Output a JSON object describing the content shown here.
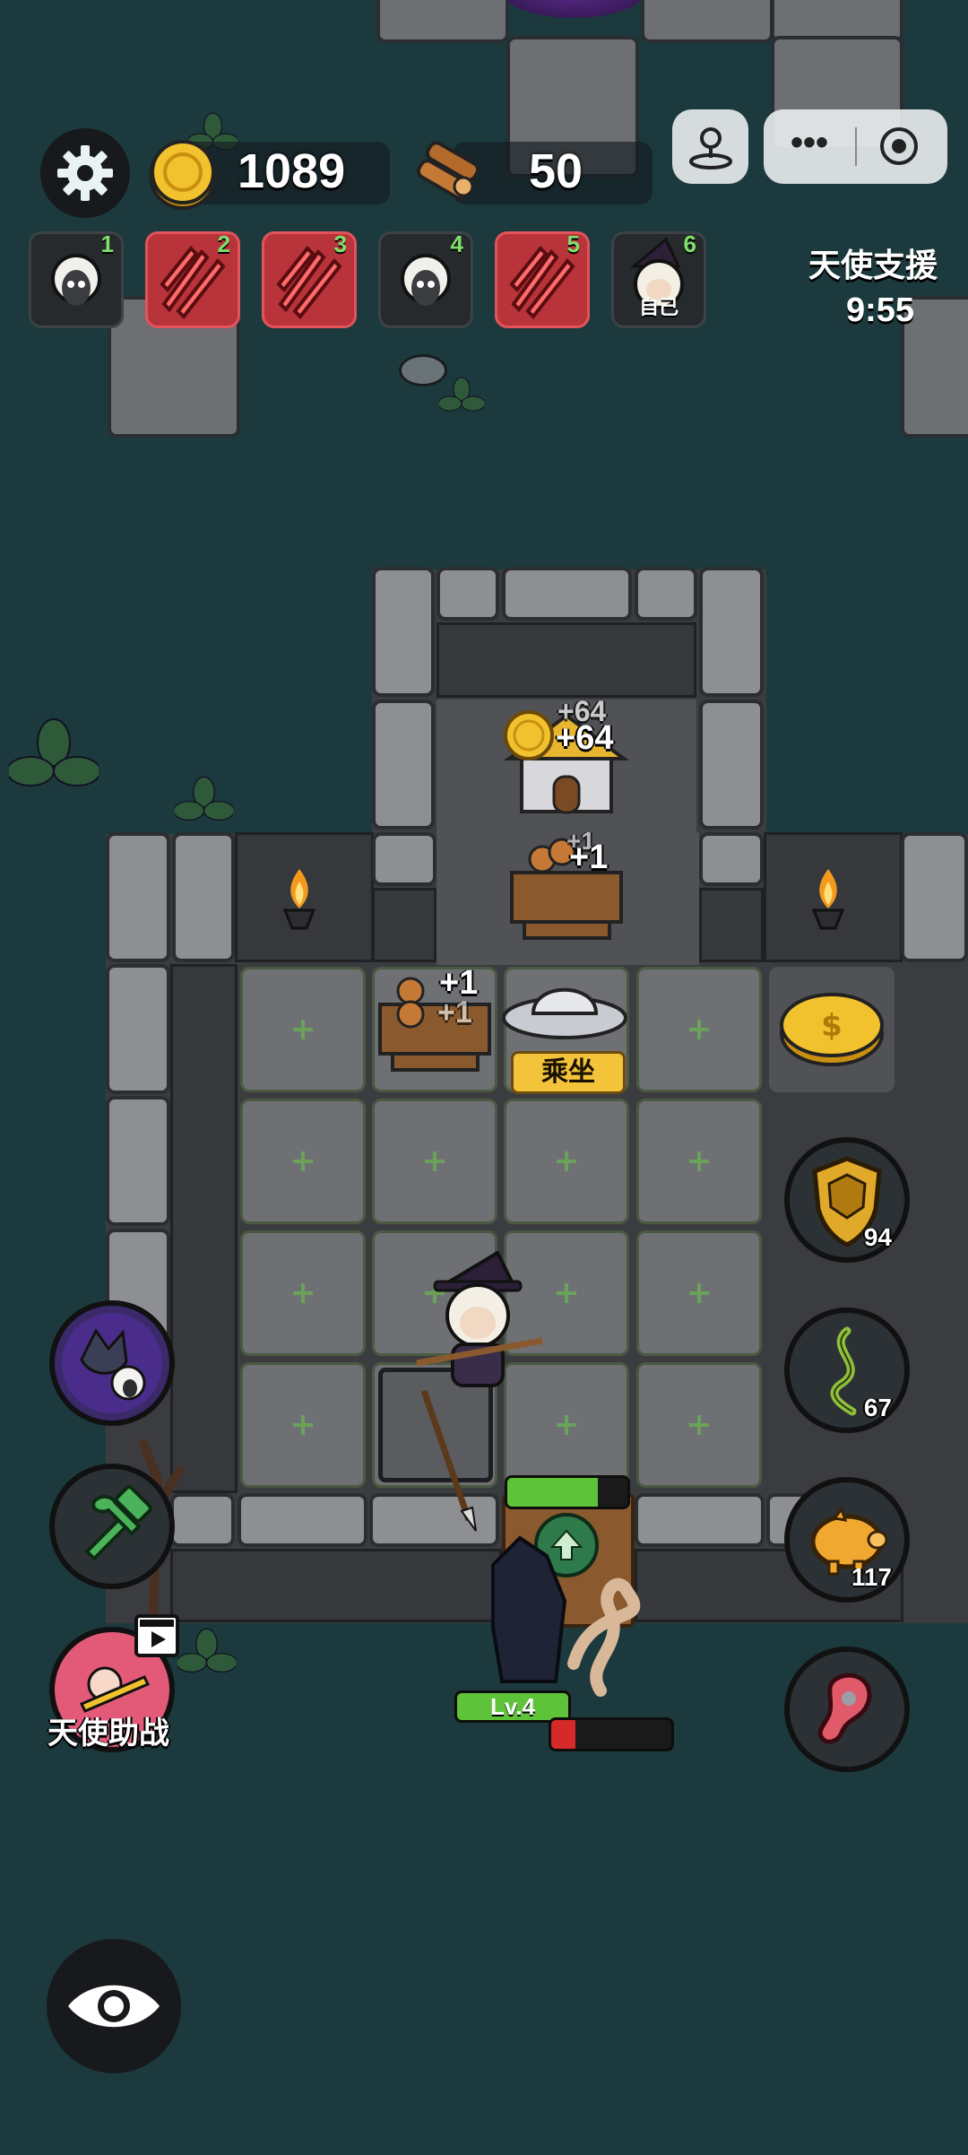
{
  "colors": {
    "background": "#1c3a3d",
    "gold": "#f2c12e",
    "hp_green": "#5fc33a",
    "enemy_red": "#d62a2a",
    "slot_red": "#b8343a",
    "board_button": "#f3c43a"
  },
  "top_bar": {
    "settings_icon": "gear-icon",
    "gold": {
      "icon": "gold-coin-icon",
      "value": "1089"
    },
    "wood": {
      "icon": "wood-logs-icon",
      "value": "50"
    },
    "joystick_icon": "joystick-icon",
    "menu_icon": "more-dots-icon",
    "close_icon": "record-circle-icon"
  },
  "player_slots": [
    {
      "number": "1",
      "state": "sheep",
      "icon": "sheep-portrait-icon"
    },
    {
      "number": "2",
      "state": "attacked",
      "icon": "claw-slash-icon"
    },
    {
      "number": "3",
      "state": "attacked",
      "icon": "claw-slash-icon"
    },
    {
      "number": "4",
      "state": "sheep",
      "icon": "sheep-portrait-icon"
    },
    {
      "number": "5",
      "state": "attacked",
      "icon": "claw-slash-icon"
    },
    {
      "number": "6",
      "state": "self",
      "icon": "witch-sheep-portrait-icon",
      "label": "自己"
    }
  ],
  "angel_support": {
    "title": "天使支援",
    "timer": "9:55"
  },
  "board": {
    "house_gain_1": "+64",
    "house_gain_2": "+64",
    "wood_gain_top": "+1",
    "wood_gain_top_ghost": "+1",
    "wood_gain_left": "+1",
    "wood_gain_left_ghost": "+1",
    "ride_button": "乘坐"
  },
  "right_buttons": [
    {
      "icon": "shield-icon",
      "count": "94"
    },
    {
      "icon": "thorn-vine-icon",
      "count": "67"
    },
    {
      "icon": "piggy-bank-icon",
      "count": "117"
    },
    {
      "icon": "heart-organ-icon"
    }
  ],
  "left_buttons": [
    {
      "icon": "wolf-vs-sheep-icon"
    },
    {
      "icon": "hammer-wrench-icon"
    },
    {
      "icon": "angel-helper-icon",
      "video_icon": "video-ad-icon",
      "label": "天使助战"
    }
  ],
  "enemy": {
    "level": "Lv.4",
    "hp_fraction": 0.2
  },
  "door_hp_fraction": 0.75,
  "view_icon": "eye-icon"
}
